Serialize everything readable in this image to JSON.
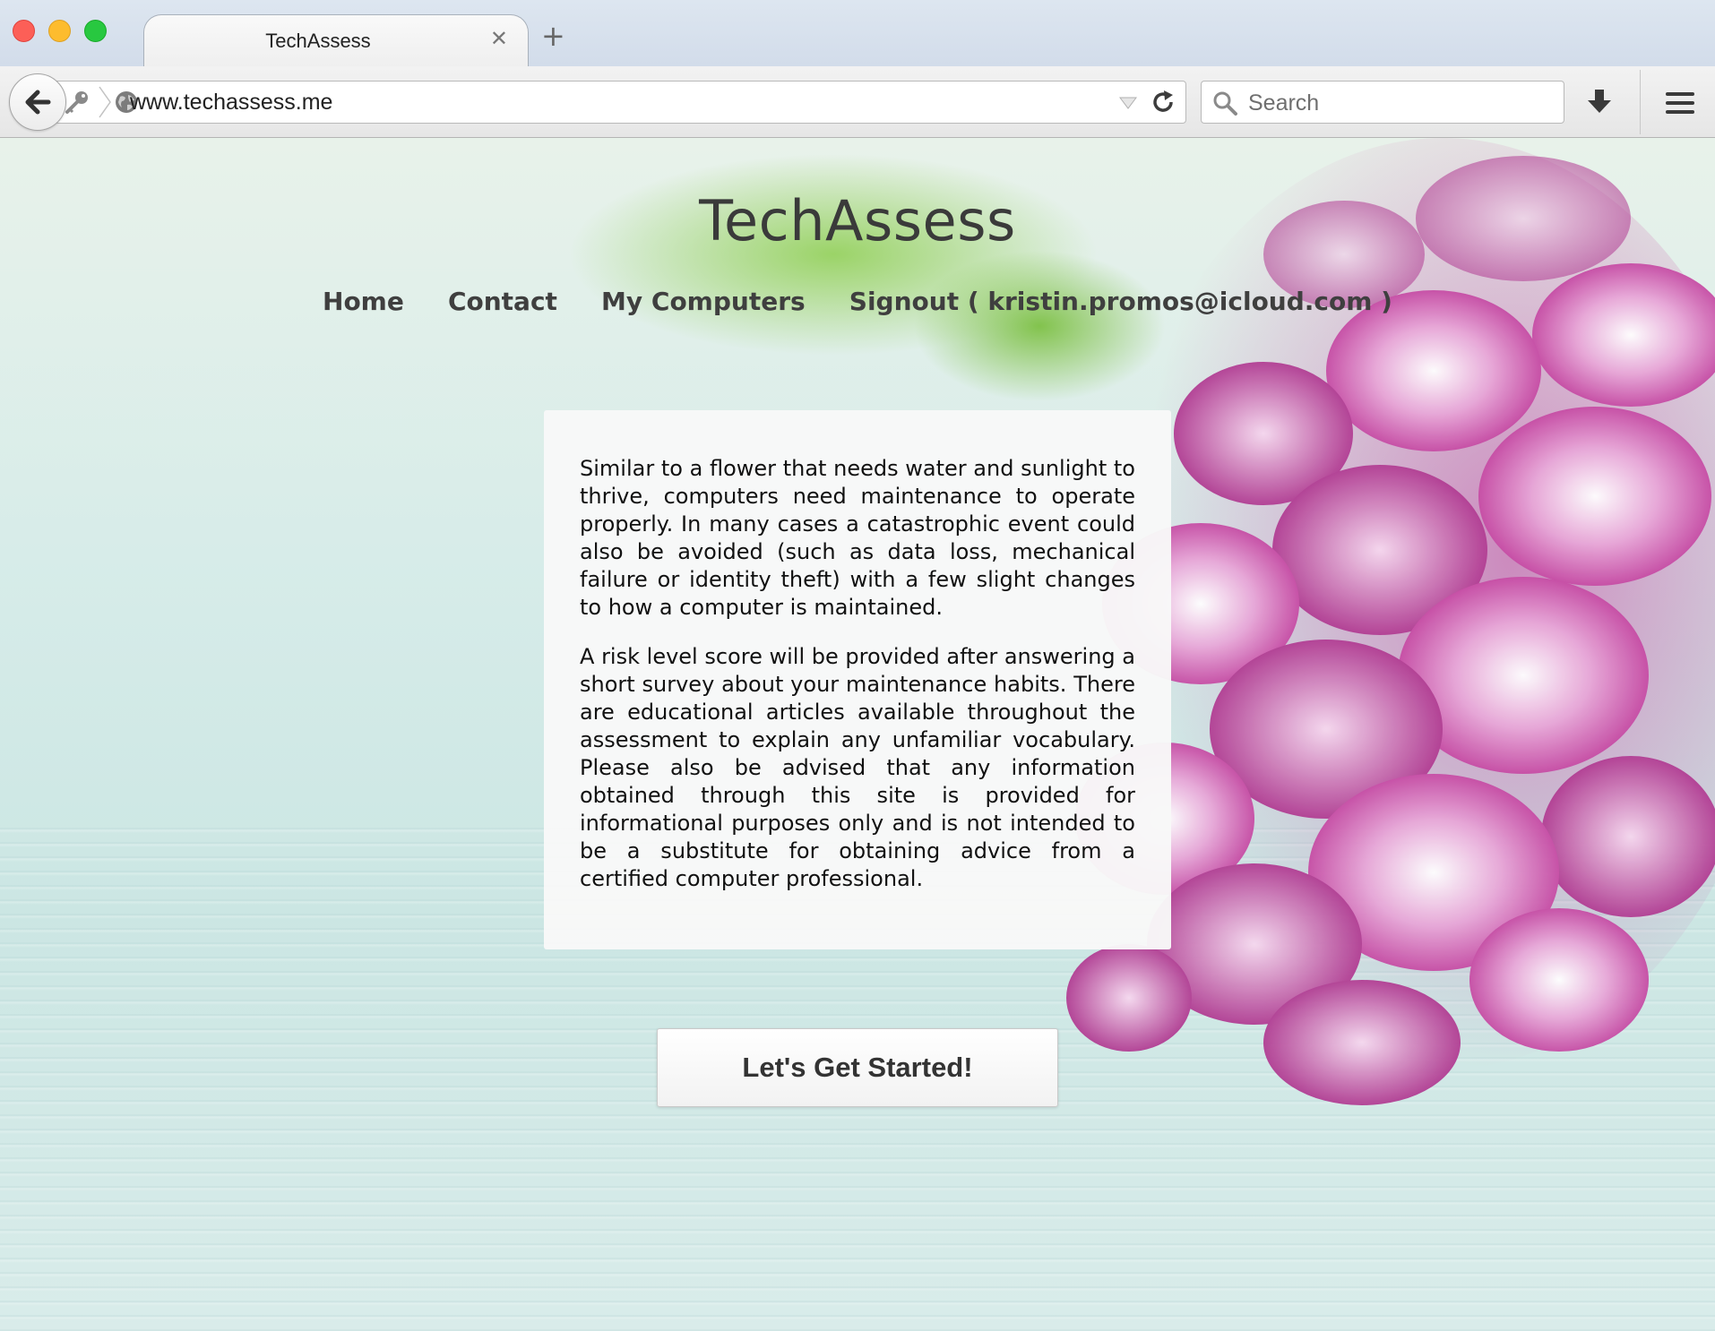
{
  "browser": {
    "tab": {
      "title": "TechAssess",
      "close_glyph": "✕"
    },
    "new_tab_glyph": "+",
    "address": {
      "url": "www.techassess.me"
    },
    "search": {
      "placeholder": "Search"
    },
    "icons": {
      "back": "back-arrow-icon",
      "identity": "key-icon",
      "site": "globe-icon",
      "history_dropdown": "chevron-down-icon",
      "reload": "reload-icon",
      "search": "search-icon",
      "downloads": "download-icon",
      "menu": "hamburger-menu-icon"
    }
  },
  "site": {
    "title": "TechAssess",
    "nav": {
      "home": "Home",
      "contact": "Contact",
      "my_computers": "My Computers",
      "signout": "Signout ( kristin.promos@icloud.com )"
    },
    "intro": {
      "paragraph_1": "Similar to a flower that needs water and sunlight to thrive, computers need maintenance to operate properly. In many cases a catastrophic event could also be avoided (such as data loss, mechanical failure or identity theft) with a few slight changes to how a computer is maintained.",
      "paragraph_2": "A risk level score will be provided after answering a short survey about your maintenance habits. There are educational articles available throughout the assessment to explain any unfamiliar vocabulary. Please also be advised that any information obtained through this site is provided for informational purposes only and is not intended to be a substitute for obtaining advice from a certified computer professional."
    },
    "cta_label": "Let's Get Started!"
  },
  "colors": {
    "traffic_red": "#fc5f57",
    "traffic_yellow": "#fdbc2e",
    "traffic_green": "#28c840",
    "flower_magenta": "#b8268f",
    "leaf_green": "#8ece50",
    "background_mint": "#d7ece9"
  }
}
